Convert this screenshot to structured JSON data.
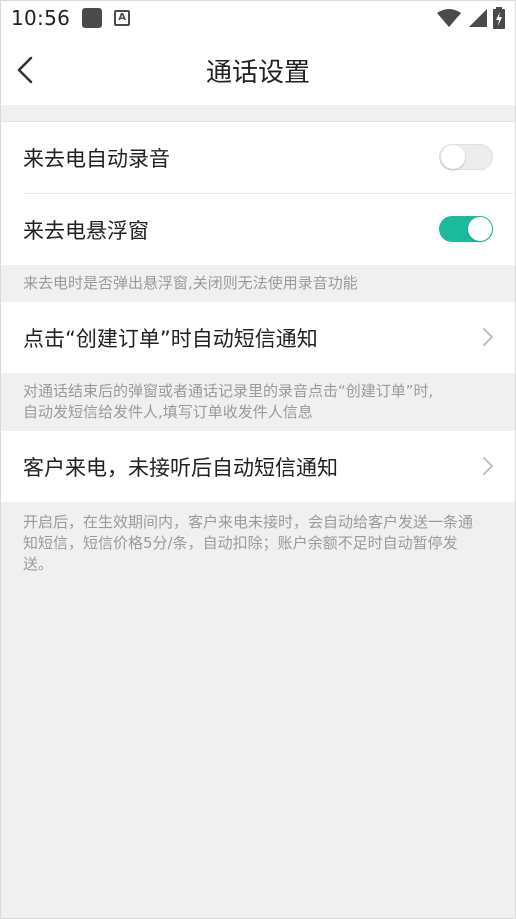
{
  "status_bar": {
    "time": "10:56"
  },
  "header": {
    "title": "通话设置"
  },
  "settings": {
    "auto_record": {
      "label": "来去电自动录音",
      "enabled": false
    },
    "floating_window": {
      "label": "来去电悬浮窗",
      "enabled": true
    },
    "floating_note": "来去电时是否弹出悬浮窗,关闭则无法使用录音功能",
    "order_sms": {
      "label": "点击“创建订单”时自动短信通知"
    },
    "order_note_line1": "对通话结束后的弹窗或者通话记录里的录音点击“创建订单”时,",
    "order_note_line2": "自动发短信给发件人,填写订单收发件人信息",
    "missed_sms": {
      "label": "客户来电，未接听后自动短信通知"
    },
    "missed_note_line1": "开启后，在生效期间内，客户来电未接时，会自动给客户发送一条通",
    "missed_note_line2": "知短信，短信价格5分/条，自动扣除；账户余额不足时自动暂停发",
    "missed_note_line3": "送。"
  },
  "colors": {
    "accent": "#1aba9b",
    "background": "#f0f0f0",
    "note_text": "#9a9a9a"
  }
}
